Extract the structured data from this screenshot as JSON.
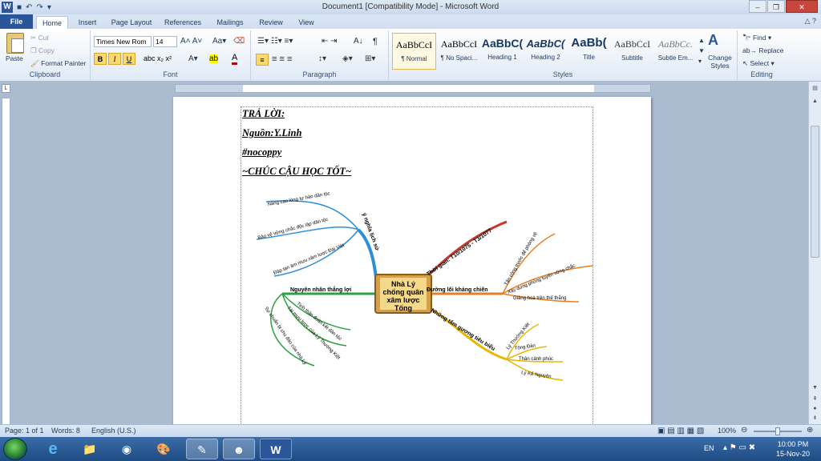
{
  "title": "Document1 [Compatibility Mode] - Microsoft Word",
  "tabs": [
    "File",
    "Home",
    "Insert",
    "Page Layout",
    "References",
    "Mailings",
    "Review",
    "View"
  ],
  "clipboard": {
    "paste": "Paste",
    "cut": "Cut",
    "copy": "Copy",
    "format_painter": "Format Painter",
    "label": "Clipboard"
  },
  "font": {
    "name": "Times New Rom",
    "size": "14",
    "label": "Font",
    "bold": "B",
    "italic": "I",
    "underline": "U"
  },
  "paragraph": {
    "label": "Paragraph"
  },
  "styles": {
    "label": "Styles",
    "items": [
      {
        "preview": "AaBbCcI",
        "name": "¶ Normal"
      },
      {
        "preview": "AaBbCcI",
        "name": "¶ No Spaci..."
      },
      {
        "preview": "AaBbC(",
        "name": "Heading 1"
      },
      {
        "preview": "AaBbC(",
        "name": "Heading 2"
      },
      {
        "preview": "AaBb(",
        "name": "Title"
      },
      {
        "preview": "AaBbCcI",
        "name": "Subtitle"
      },
      {
        "preview": "AaBbCc.",
        "name": "Subtle Em..."
      }
    ],
    "change": "Change Styles"
  },
  "editing": {
    "find": "Find",
    "replace": "Replace",
    "select": "Select",
    "label": "Editing"
  },
  "document": {
    "lines": [
      "TRẢ LỜI:",
      "Nguồn:Y.Linh",
      "#nocoppy",
      "~CHÚC CẬU HỌC TỐT~"
    ]
  },
  "mindmap": {
    "center": [
      "Nhà Lý",
      "chống quân",
      "xâm lược",
      "Tống"
    ],
    "branches": {
      "y_nghia": "ý nghĩa lịch sử",
      "y_nghia_items": [
        "Nâng cao lòng tự hào dân tộc",
        "Bảo vệ vững chắc độc lập dân tộc",
        "Đập tan âm mưu xâm lược Đại Việt"
      ],
      "thoi_gian": "Thời gian: T10/1075 - T3/1077",
      "duong_loi": "Đường lối kháng chiến",
      "duong_loi_items": [
        "Tấn công trước để phòng vệ",
        "Xây dựng phòng tuyến vững chắc",
        "Giảng hoà trên thế thắng"
      ],
      "guong": "Những tấm gương tiêu biểu",
      "guong_items": [
        "Lý Thường Kiệt",
        "Tông Đản",
        "Thân cảnh phúc",
        "Lý Kế Nguyên"
      ],
      "nguyen_nhan": "Nguyên nhân thắng lợi",
      "nguyen_nhan_items": [
        "Tinh thần đoàn kết dân tộc",
        "Tài mưu lược của Lý Thường Kiệt",
        "Sự chuẩn bị chu đáo của nhà Lý"
      ]
    },
    "colors": {
      "blue": "#2f8fd6",
      "red": "#c0392b",
      "orange": "#e67e22",
      "yellow": "#e6b800",
      "green": "#2ea043"
    }
  },
  "status": {
    "page": "Page: 1 of 1",
    "words": "Words: 8",
    "lang": "English (U.S.)",
    "zoom": "100%"
  },
  "taskbar": {
    "lang": "EN",
    "time": "10:00 PM",
    "date": "15-Nov-20"
  }
}
